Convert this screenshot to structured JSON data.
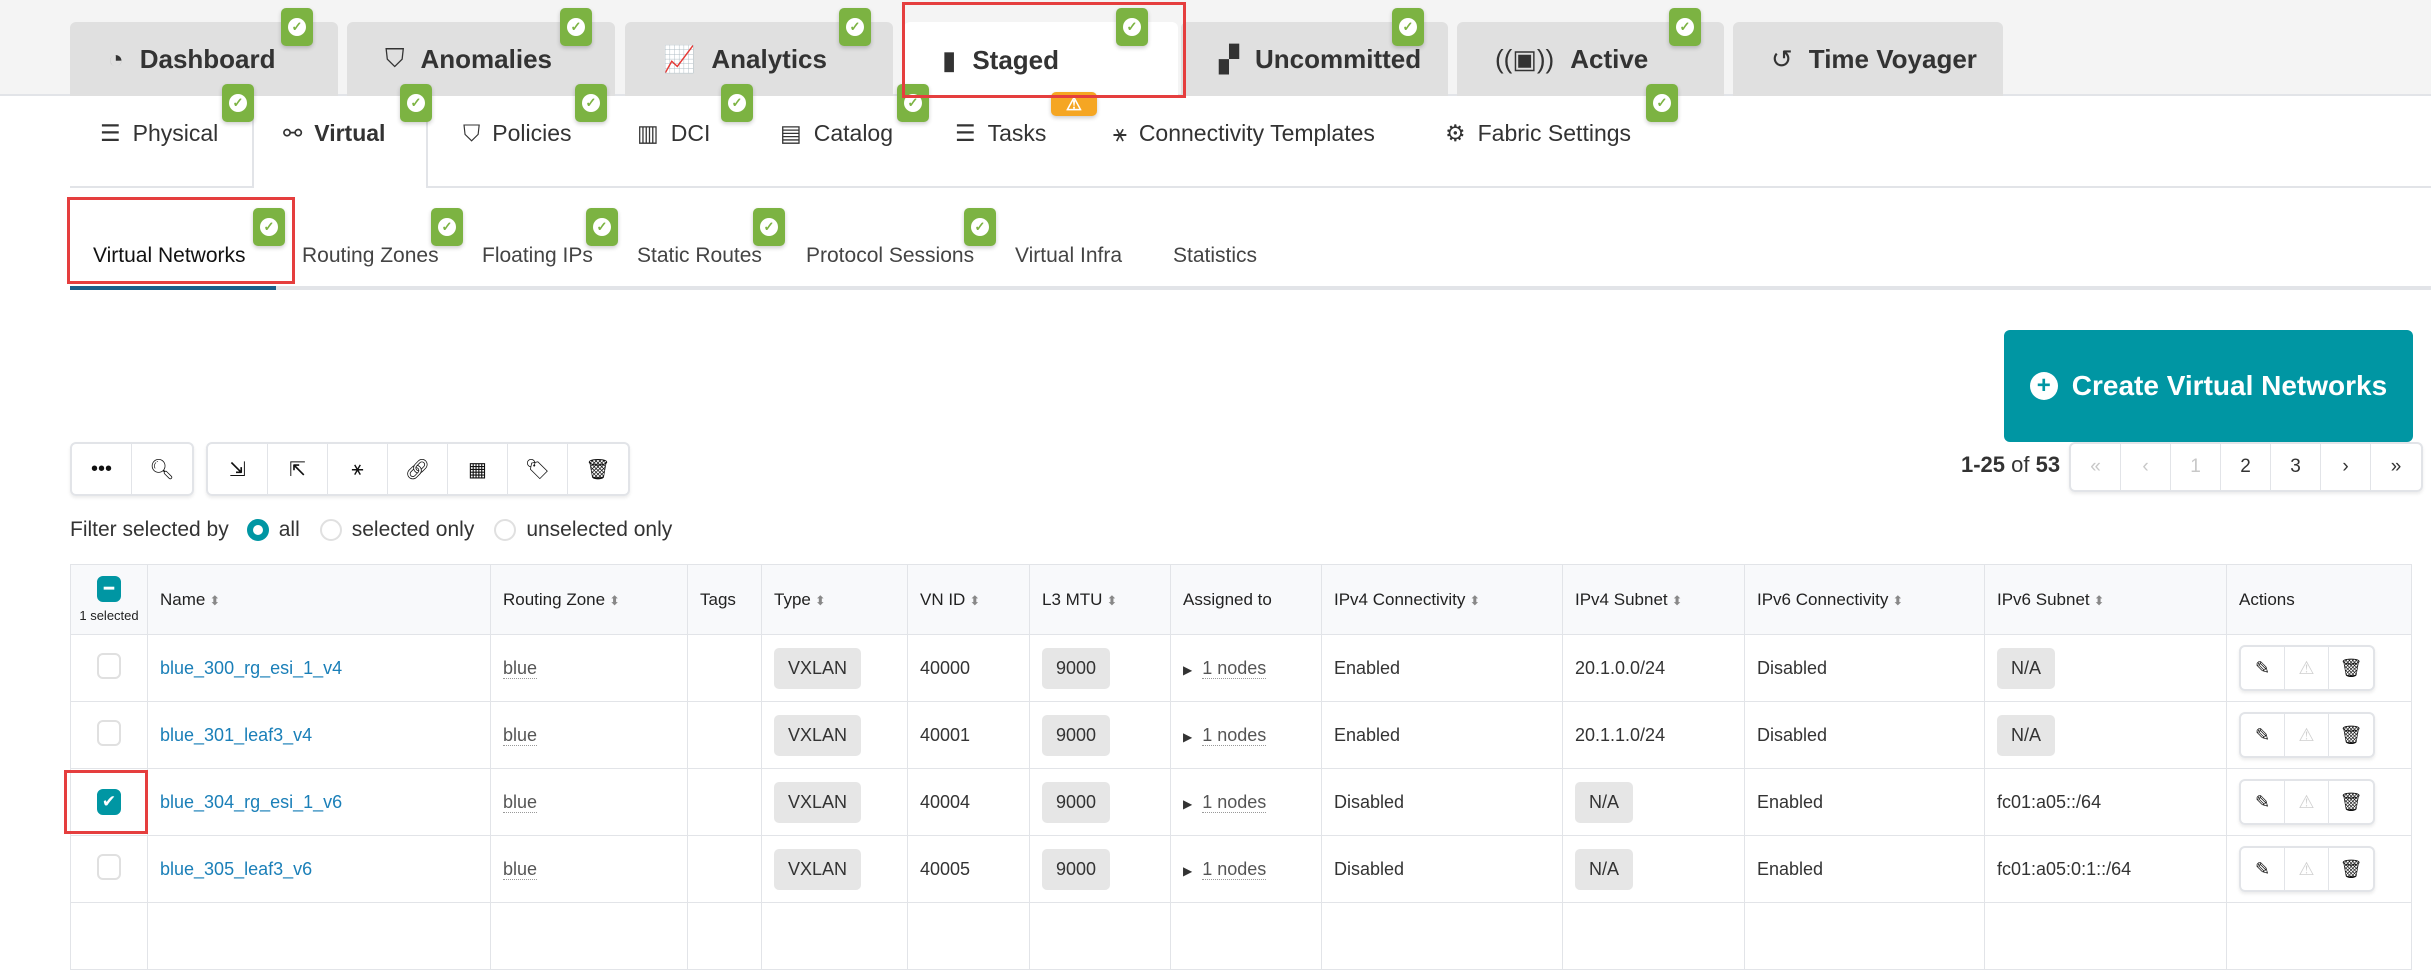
{
  "top_tabs": [
    {
      "label": "Dashboard",
      "icon": "dashboard-icon",
      "glyph": "◔",
      "badge": true
    },
    {
      "label": "Anomalies",
      "icon": "shield-icon",
      "glyph": "⛉",
      "badge": true
    },
    {
      "label": "Analytics",
      "icon": "chart-icon",
      "glyph": "📈",
      "badge": true
    },
    {
      "label": "Staged",
      "icon": "document-icon",
      "glyph": "▮",
      "badge": true,
      "active": true
    },
    {
      "label": "Uncommitted",
      "icon": "uncommitted-icon",
      "glyph": "▞",
      "badge": true
    },
    {
      "label": "Active",
      "icon": "broadcast-icon",
      "glyph": "((▣))",
      "badge": true
    },
    {
      "label": "Time Voyager",
      "icon": "history-icon",
      "glyph": "↺",
      "badge": false
    }
  ],
  "nav": [
    {
      "label": "Physical",
      "glyph": "☰"
    },
    {
      "label": "Virtual",
      "glyph": "⚯"
    },
    {
      "label": "Policies",
      "glyph": "⛉"
    },
    {
      "label": "DCI",
      "glyph": "▥"
    },
    {
      "label": "Catalog",
      "glyph": "▤"
    },
    {
      "label": "Tasks",
      "glyph": "☰"
    },
    {
      "label": "Connectivity Templates",
      "glyph": "⚹"
    },
    {
      "label": "Fabric Settings",
      "glyph": "⚙"
    }
  ],
  "subtabs": [
    "Virtual Networks",
    "Routing Zones",
    "Floating IPs",
    "Static Routes",
    "Protocol Sessions",
    "Virtual Infra",
    "Statistics"
  ],
  "create_button": "Create Virtual Networks",
  "pagination": {
    "range": "1-25",
    "of": "of",
    "total": "53",
    "pages": [
      "«",
      "‹",
      "1",
      "2",
      "3",
      "›",
      "»"
    ]
  },
  "filter": {
    "label": "Filter selected by",
    "options": [
      "all",
      "selected only",
      "unselected only"
    ],
    "selected": "all"
  },
  "table": {
    "selected_count": "1 selected",
    "headers": [
      "Name",
      "Routing Zone",
      "Tags",
      "Type",
      "VN ID",
      "L3 MTU",
      "Assigned to",
      "IPv4 Connectivity",
      "IPv4 Subnet",
      "IPv6 Connectivity",
      "IPv6 Subnet",
      "Actions"
    ],
    "rows": [
      {
        "checked": false,
        "name": "blue_300_rg_esi_1_v4",
        "zone": "blue",
        "tags": "",
        "type": "VXLAN",
        "vnid": "40000",
        "mtu": "9000",
        "assigned": "1 nodes",
        "ipv4c": "Enabled",
        "ipv4s": "20.1.0.0/24",
        "ipv6c": "Disabled",
        "ipv6s": "N/A"
      },
      {
        "checked": false,
        "name": "blue_301_leaf3_v4",
        "zone": "blue",
        "tags": "",
        "type": "VXLAN",
        "vnid": "40001",
        "mtu": "9000",
        "assigned": "1 nodes",
        "ipv4c": "Enabled",
        "ipv4s": "20.1.1.0/24",
        "ipv6c": "Disabled",
        "ipv6s": "N/A"
      },
      {
        "checked": true,
        "name": "blue_304_rg_esi_1_v6",
        "zone": "blue",
        "tags": "",
        "type": "VXLAN",
        "vnid": "40004",
        "mtu": "9000",
        "assigned": "1 nodes",
        "ipv4c": "Disabled",
        "ipv4s": "N/A",
        "ipv6c": "Enabled",
        "ipv6s": "fc01:a05::/64"
      },
      {
        "checked": false,
        "name": "blue_305_leaf3_v6",
        "zone": "blue",
        "tags": "",
        "type": "VXLAN",
        "vnid": "40005",
        "mtu": "9000",
        "assigned": "1 nodes",
        "ipv4c": "Disabled",
        "ipv4s": "N/A",
        "ipv6c": "Enabled",
        "ipv6s": "fc01:a05:0:1::/64"
      }
    ]
  },
  "colors": {
    "accent": "#0096a3",
    "badge_ok": "#7cb342",
    "badge_warn": "#f5a623",
    "highlight": "#e53e3e",
    "link": "#1a7fb8"
  }
}
